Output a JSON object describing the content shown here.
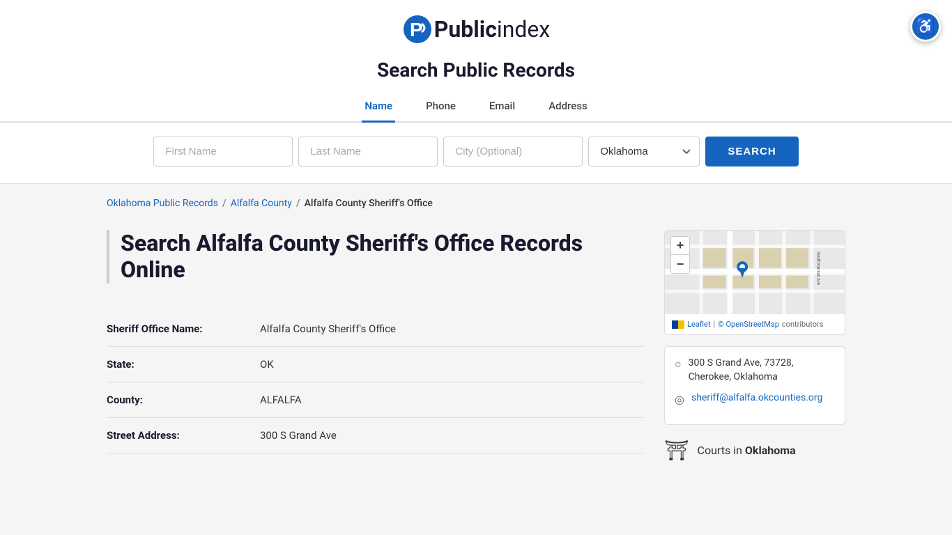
{
  "logo": {
    "public_text": "Public",
    "index_text": "index"
  },
  "header": {
    "title": "Search Public Records",
    "tabs": [
      {
        "id": "name",
        "label": "Name",
        "active": true
      },
      {
        "id": "phone",
        "label": "Phone",
        "active": false
      },
      {
        "id": "email",
        "label": "Email",
        "active": false
      },
      {
        "id": "address",
        "label": "Address",
        "active": false
      }
    ]
  },
  "search": {
    "first_name_placeholder": "First Name",
    "last_name_placeholder": "Last Name",
    "city_placeholder": "City (Optional)",
    "state_value": "Oklahoma",
    "search_label": "SEARCH"
  },
  "breadcrumb": {
    "link1": "Oklahoma Public Records",
    "sep1": "/",
    "link2": "Alfalfa County",
    "sep2": "/",
    "current": "Alfalfa County Sheriff's Office"
  },
  "page_heading": "Search Alfalfa County Sheriff's Office Records Online",
  "fields": [
    {
      "label": "Sheriff Office Name:",
      "value": "Alfalfa County Sheriff's Office"
    },
    {
      "label": "State:",
      "value": "OK"
    },
    {
      "label": "County:",
      "value": "ALFALFA"
    },
    {
      "label": "Street Address:",
      "value": "300 S Grand Ave"
    }
  ],
  "map": {
    "zoom_in": "+",
    "zoom_out": "−",
    "leaflet_label": "Leaflet",
    "osm_label": "© OpenStreetMap",
    "osm_suffix": "contributors"
  },
  "address_card": {
    "address": "300 S Grand Ave, 73728,\nCherokee, Oklahoma",
    "email": "sheriff@alfalfa.okcounties.org"
  },
  "courts": {
    "label": "Courts in",
    "state": "Oklahoma"
  },
  "accessibility": {
    "label": "Accessibility"
  }
}
